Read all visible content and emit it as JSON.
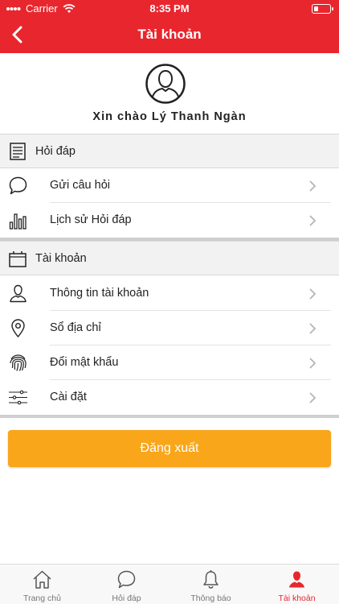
{
  "status_bar": {
    "carrier": "Carrier",
    "time": "8:35 PM",
    "battery_level": 0.25
  },
  "nav": {
    "title": "Tài khoản"
  },
  "profile": {
    "greeting": "Xin chào Lý Thanh Ngàn"
  },
  "sections": [
    {
      "title": "Hỏi đáp",
      "icon": "document-icon",
      "items": [
        {
          "label": "Gửi câu hỏi",
          "icon": "chat-bubble-icon"
        },
        {
          "label": "Lịch sử Hỏi đáp",
          "icon": "bar-chart-icon"
        }
      ]
    },
    {
      "title": "Tài khoản",
      "icon": "briefcase-icon",
      "items": [
        {
          "label": "Thông tin tài khoản",
          "icon": "user-icon"
        },
        {
          "label": "Sổ địa chỉ",
          "icon": "location-pin-icon"
        },
        {
          "label": "Đổi mật khẩu",
          "icon": "fingerprint-icon"
        },
        {
          "label": "Cài đặt",
          "icon": "sliders-icon"
        }
      ]
    }
  ],
  "logout": {
    "label": "Đăng xuất"
  },
  "tabs": [
    {
      "label": "Trang chủ",
      "icon": "home-icon",
      "active": false
    },
    {
      "label": "Hỏi đáp",
      "icon": "chat-bubble-icon",
      "active": false
    },
    {
      "label": "Thông báo",
      "icon": "bell-icon",
      "active": false
    },
    {
      "label": "Tài khoản",
      "icon": "user-icon",
      "active": true
    }
  ],
  "colors": {
    "brand": "#e8262e",
    "logout": "#f9a61a",
    "tab_inactive": "#777777"
  }
}
